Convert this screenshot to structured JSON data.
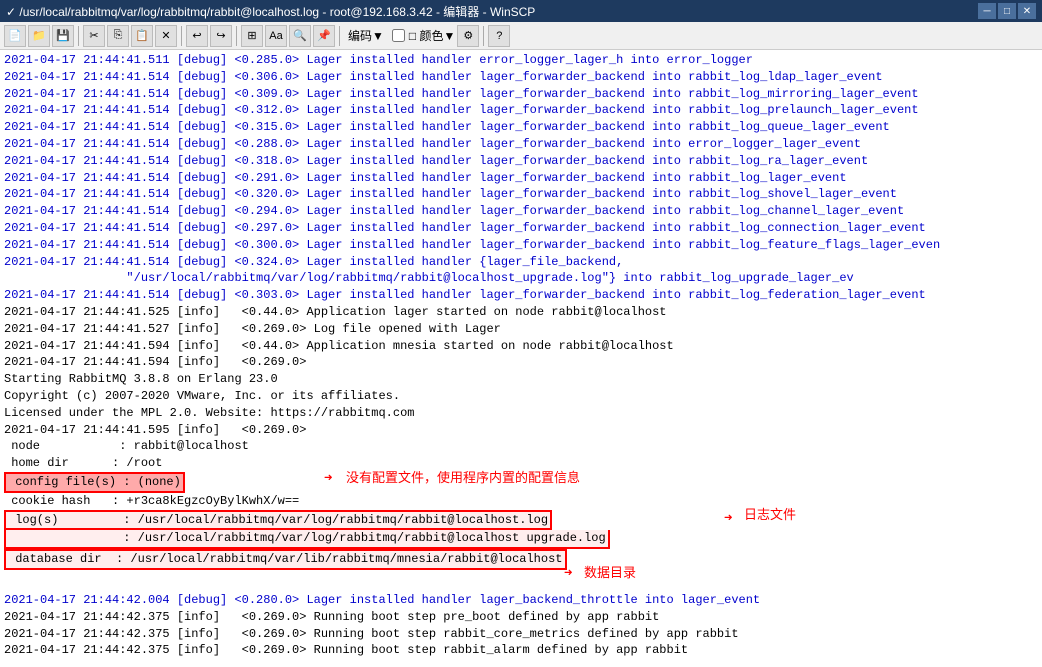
{
  "titlebar": {
    "text": "✓ /usr/local/rabbitmq/var/log/rabbitmq/rabbit@localhost.log - root@192.168.3.42 - 编辑器 - WinSCP"
  },
  "toolbar": {
    "encoding_label": "编码▼",
    "color_label": "□ 颜色▼",
    "help_label": "?"
  },
  "log_lines": [
    "2021-04-17  21:44:41.511  [debug]  <0.285.0>  Lager  installed  handler  error_logger_lager_h  into  error_logger",
    "2021-04-17  21:44:41.514  [debug]  <0.306.0>  Lager  installed  handler  lager_forwarder_backend  into  rabbit_log_ldap_lager_event",
    "2021-04-17  21:44:41.514  [debug]  <0.309.0>  Lager  installed  handler  lager_forwarder_backend  into  rabbit_log_mirroring_lager_event",
    "2021-04-17  21:44:41.514  [debug]  <0.312.0>  Lager  installed  handler  lager_forwarder_backend  into  rabbit_log_prelaunch_lager_event",
    "2021-04-17  21:44:41.514  [debug]  <0.315.0>  Lager  installed  handler  lager_forwarder_backend  into  rabbit_log_queue_lager_event",
    "2021-04-17  21:44:41.514  [debug]  <0.288.0>  Lager  installed  handler  lager_forwarder_backend  into  error_logger_lager_event",
    "2021-04-17  21:44:41.514  [debug]  <0.318.0>  Lager  installed  handler  lager_forwarder_backend  into  rabbit_log_ra_lager_event",
    "2021-04-17  21:44:41.514  [debug]  <0.291.0>  Lager  installed  handler  lager_forwarder_backend  into  rabbit_log_lager_event",
    "2021-04-17  21:44:41.514  [debug]  <0.320.0>  Lager  installed  handler  lager_forwarder_backend  into  rabbit_log_shovel_lager_event",
    "2021-04-17  21:44:41.514  [debug]  <0.294.0>  Lager  installed  handler  lager_forwarder_backend  into  rabbit_log_channel_lager_event",
    "2021-04-17  21:44:41.514  [debug]  <0.297.0>  Lager  installed  handler  lager_forwarder_backend  into  rabbit_log_connection_lager_event",
    "2021-04-17  21:44:41.514  [debug]  <0.300.0>  Lager  installed  handler  lager_forwarder_backend  into  rabbit_log_feature_flags_lager_even",
    "2021-04-17  21:44:41.514  [debug]  <0.324.0>  Lager  installed  handler  {lager_file_backend,",
    "                 \"/usr/local/rabbitmq/var/log/rabbitmq/rabbit@localhost_upgrade.log\"}  into  rabbit_log_upgrade_lager_ev",
    "2021-04-17  21:44:41.514  [debug]  <0.303.0>  Lager  installed  handler  lager_forwarder_backend  into  rabbit_log_federation_lager_event",
    "2021-04-17  21:44:41.525  [info]   <0.44.0>  Application  lager  started  on  node  rabbit@localhost",
    "2021-04-17  21:44:41.527  [info]   <0.269.0>  Log  file  opened  with  Lager",
    "2021-04-17  21:44:41.594  [info]   <0.44.0>  Application  mnesia  started  on  node  rabbit@localhost",
    "2021-04-17  21:44:41.594  [info]   <0.269.0>",
    "Starting  RabbitMQ  3.8.8  on  Erlang  23.0",
    "Copyright  (c)  2007-2020  VMware,  Inc.  or  its  affiliates.",
    "Licensed  under  the  MPL  2.0.  Website:  https://rabbitmq.com",
    "2021-04-17  21:44:41.595  [info]   <0.269.0>",
    " node           :  rabbit@localhost",
    " home  dir      :  /root",
    " config  file(s)  :  (none)",
    " cookie  hash   :  +r3ca8kEgzcOyBylKwhX/w==",
    " log(s)         :  /usr/local/rabbitmq/var/log/rabbitmq/rabbit@localhost.log",
    "                :  /usr/local/rabbitmq/var/log/rabbitmq/rabbit@localhost  upgrade.log",
    " database  dir  :  /usr/local/rabbitmq/var/lib/rabbitmq/mnesia/rabbit@localhost",
    "2021-04-17  21:44:42.004  [debug]  <0.280.0>  Lager  installed  handler  lager_backend_throttle  into  lager_event",
    "2021-04-17  21:44:42.375  [info]   <0.269.0>  Running  boot  step  pre_boot  defined  by  app  rabbit",
    "2021-04-17  21:44:42.375  [info]   <0.269.0>  Running  boot  step  rabbit_core_metrics  defined  by  app  rabbit",
    "2021-04-17  21:44:42.375  [info]   <0.269.0>  Running  boot  step  rabbit_alarm  defined  by  app  rabbit"
  ],
  "annotations": {
    "no_config": "没有配置文件，使用程序内置的配置信息",
    "log_file": "日志文件",
    "data_dir": "数据目录"
  }
}
